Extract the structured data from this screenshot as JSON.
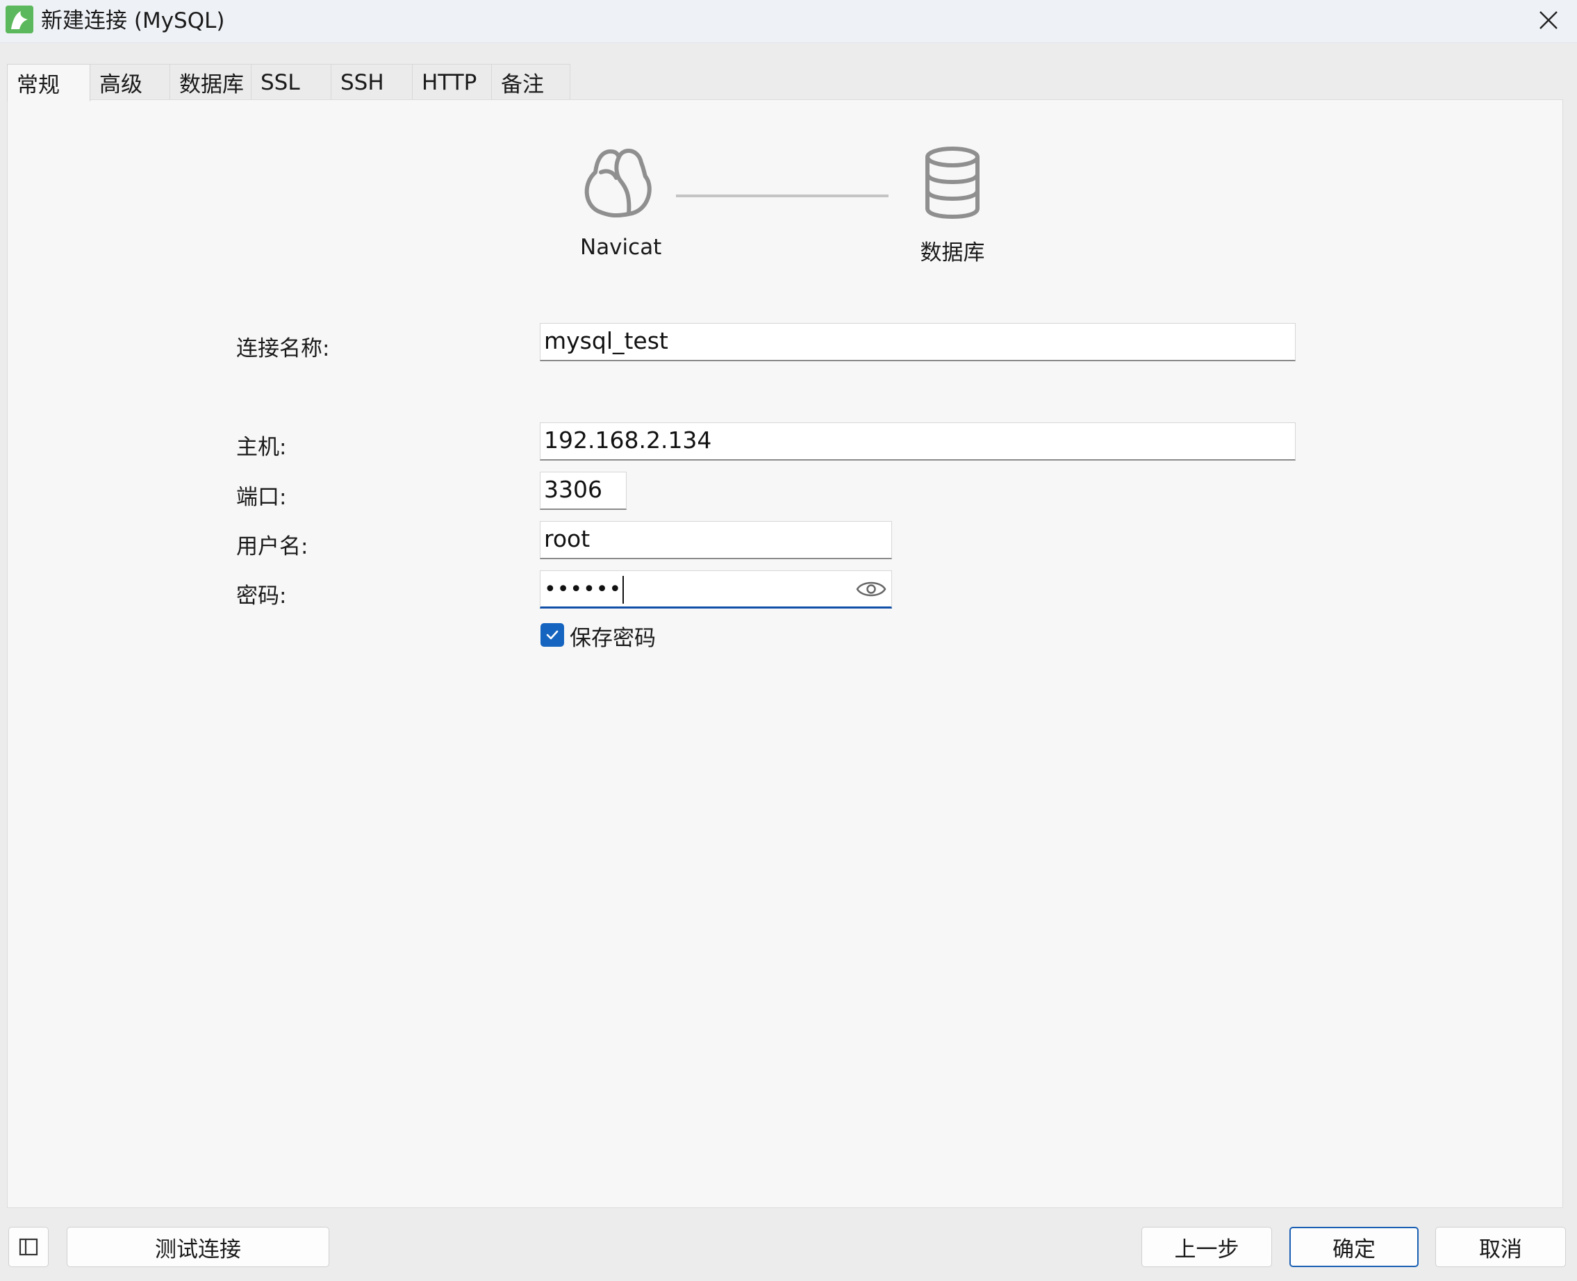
{
  "window": {
    "title": "新建连接 (MySQL)",
    "app_icon": "navicat-dolphin-icon",
    "close_icon": "close-icon"
  },
  "tabs": [
    {
      "label": "常规",
      "active": true
    },
    {
      "label": "高级",
      "active": false
    },
    {
      "label": "数据库",
      "active": false
    },
    {
      "label": "SSL",
      "active": false
    },
    {
      "label": "SSH",
      "active": false
    },
    {
      "label": "HTTP",
      "active": false
    },
    {
      "label": "备注",
      "active": false
    }
  ],
  "diagram": {
    "left_label": "Navicat",
    "right_label": "数据库",
    "left_icon": "navicat-icon",
    "right_icon": "database-icon"
  },
  "form": {
    "connection_name": {
      "label": "连接名称:",
      "value": "mysql_test"
    },
    "host": {
      "label": "主机:",
      "value": "192.168.2.134"
    },
    "port": {
      "label": "端口:",
      "value": "3306"
    },
    "username": {
      "label": "用户名:",
      "value": "root"
    },
    "password": {
      "label": "密码:",
      "value": "••••••",
      "reveal_icon": "eye-icon"
    },
    "save_password": {
      "label": "保存密码",
      "checked": true
    }
  },
  "footer": {
    "sidebar_toggle_icon": "sidebar-panel-icon",
    "test_connection": "测试连接",
    "back": "上一步",
    "ok": "确定",
    "cancel": "取消"
  },
  "colors": {
    "accent": "#1565c0",
    "primary_border": "#1a5fb4",
    "app_icon_bg": "#5cb85c"
  }
}
